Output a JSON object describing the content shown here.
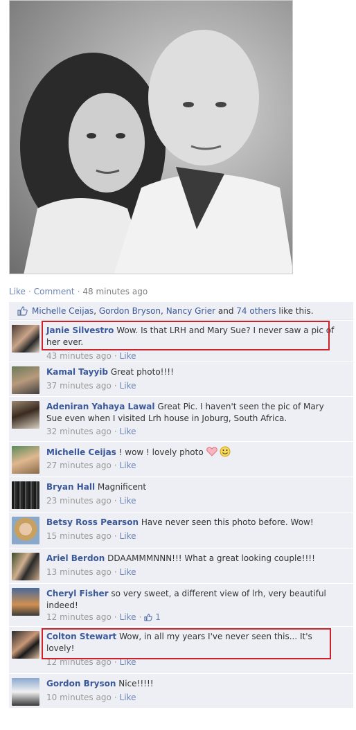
{
  "post": {
    "actions": {
      "like": "Like",
      "comment": "Comment",
      "time": "48 minutes ago"
    },
    "likes": {
      "names": [
        "Michelle Ceijas",
        "Gordon Bryson",
        "Nancy Grier"
      ],
      "and": "and",
      "others": "74 others",
      "suffix": "like this."
    }
  },
  "colors": {
    "link": "#3b5998",
    "highlight": "#d0202a",
    "comment_bg": "#edeff4"
  },
  "comments": [
    {
      "author": "Janie Silvestro",
      "text": "Wow. Is that LRH and Mary Sue? I never saw a pic of her ever.",
      "time": "43 minutes ago",
      "like": "Like"
    },
    {
      "author": "Kamal Tayyib",
      "text": "Great photo!!!!",
      "time": "37 minutes ago",
      "like": "Like"
    },
    {
      "author": "Adeniran Yahaya Lawal",
      "text": "Great Pic. I haven't seen the pic of Mary Sue even when I visited Lrh house in Joburg, South Africa.",
      "time": "32 minutes ago",
      "like": "Like"
    },
    {
      "author": "Michelle Ceijas",
      "text": "! wow ! lovely photo",
      "time": "27 minutes ago",
      "like": "Like"
    },
    {
      "author": "Bryan Hall",
      "text": "Magnificent",
      "time": "23 minutes ago",
      "like": "Like"
    },
    {
      "author": "Betsy Ross Pearson",
      "text": "Have never seen this photo before. Wow!",
      "time": "15 minutes ago",
      "like": "Like"
    },
    {
      "author": "Ariel Berdon",
      "text": "DDAAMMMNNN!!! What a great looking couple!!!!",
      "time": "13 minutes ago",
      "like": "Like"
    },
    {
      "author": "Cheryl Fisher",
      "text": "so very sweet, a different view of lrh, very beautiful indeed!",
      "time": "12 minutes ago",
      "like": "Like",
      "likes_count": "1"
    },
    {
      "author": "Colton Stewart",
      "text": "Wow, in all my years I've never seen this... It's lovely!",
      "time": "12 minutes ago",
      "like": "Like"
    },
    {
      "author": "Gordon Bryson",
      "text": "Nice!!!!!",
      "time": "10 minutes ago",
      "like": "Like"
    }
  ]
}
